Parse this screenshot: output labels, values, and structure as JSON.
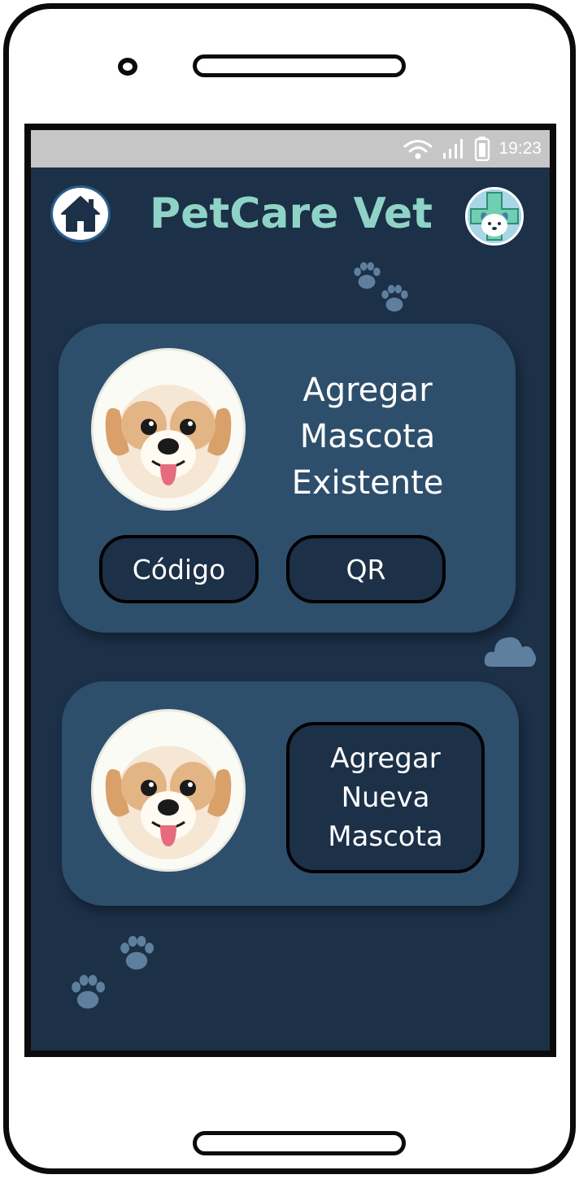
{
  "status_bar": {
    "time": "19:23",
    "icons": [
      "wifi-icon",
      "signal-icon",
      "battery-icon"
    ]
  },
  "header": {
    "title": "PetCare Vet",
    "home_icon": "home-icon",
    "logo_icon": "vet-cross-logo"
  },
  "existing_pet_card": {
    "title_lines": [
      "Agregar",
      "Mascota",
      "Existente"
    ],
    "code_button": "Código",
    "qr_button": "QR",
    "avatar_icon": "dog-avatar"
  },
  "new_pet_card": {
    "button_lines": [
      "Agregar",
      "Nueva",
      "Mascota"
    ],
    "avatar_icon": "dog-avatar"
  },
  "colors": {
    "background": "#1c3048",
    "card": "#2d4f6c",
    "title": "#8fd3c6",
    "status_bar": "#c6c6c6",
    "decoration": "#5f7f9e"
  }
}
